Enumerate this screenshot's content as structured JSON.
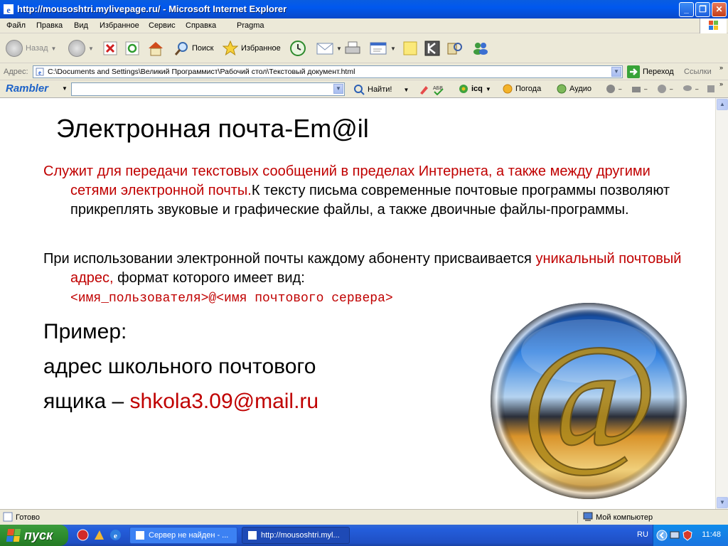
{
  "window": {
    "title": "http://mousoshtri.mylivepage.ru/ - Microsoft Internet Explorer"
  },
  "menu": [
    "Файл",
    "Правка",
    "Вид",
    "Избранное",
    "Сервис",
    "Справка",
    "Pragma"
  ],
  "toolbar": {
    "back": "Назад",
    "search": "Поиск",
    "favorites": "Избранное"
  },
  "address": {
    "label": "Адрес:",
    "value": "C:\\Documents and Settings\\Великий Программист\\Рабочий стол\\Текстовый документ.html",
    "go": "Переход",
    "links": "Ссылки"
  },
  "rambler": {
    "logo": "Rambler",
    "search_button": "Найти!",
    "icq": "icq",
    "weather": "Погода",
    "audio": "Аудио"
  },
  "page": {
    "title": "Электронная почта-Em@il",
    "p1_red": "Служит для передачи текстовых сообщений в пределах Интернета, а также между другими сетями электронной почты.",
    "p1_black": "К тексту письма современные почтовые программы позволяют прикреплять звуковые и графические файлы, а также двоичные файлы-программы.",
    "p2_start": "При использовании электронной почты каждому абоненту присваивается ",
    "p2_red": "уникальный почтовый адрес,",
    "p2_end": " формат которого имеет вид:",
    "format": "<имя_пользователя>@<имя почтового сервера>",
    "example_label": "Пример:",
    "example_line1": "адрес школьного почтового",
    "example_line2": "ящика – ",
    "example_email": "shkola3.09@mail.ru"
  },
  "status": {
    "text": "Готово",
    "zone": "Мой компьютер"
  },
  "taskbar": {
    "start": "пуск",
    "tasks": [
      "Сервер не найден - ...",
      "http://mousoshtri.myl..."
    ],
    "lang": "RU",
    "clock": "11:48"
  },
  "colors": {
    "accent_red": "#C00000",
    "titlebar_blue": "#0058EE",
    "start_green": "#2E8D2E"
  }
}
